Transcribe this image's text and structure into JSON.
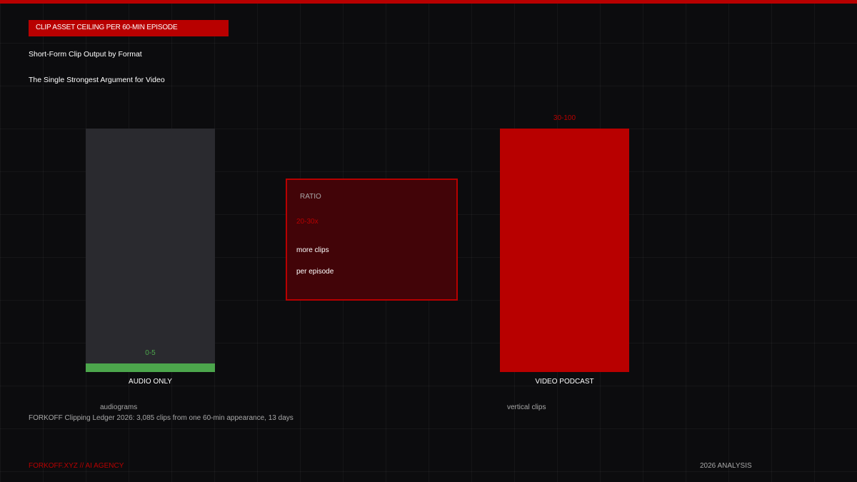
{
  "header": {
    "tag": "CLIP ASSET CEILING PER 60-MIN EPISODE",
    "title": "Short-Form Clip Output by Format",
    "subtitle": "The Single Strongest Argument for Video"
  },
  "chart_data": {
    "type": "bar",
    "title": "Short-Form Clip Output by Format",
    "subtitle": "The Single Strongest Argument for Video",
    "categories": [
      "AUDIO ONLY",
      "VIDEO PODCAST"
    ],
    "series": [
      {
        "values": [
          [
            0,
            5
          ],
          [
            30,
            100
          ]
        ],
        "value_labels": [
          "0-5",
          "30-100"
        ],
        "notes": [
          "audiograms",
          "vertical clips"
        ]
      }
    ],
    "ylim": [
      0,
      100
    ],
    "grid": true,
    "colors": {
      "audio_track": "#2a2a2f",
      "audio_fill": "#4ca64c",
      "video": "#b80000",
      "accent": "#b80000"
    }
  },
  "ratio": {
    "label": "RATIO",
    "value": "20-30x",
    "line1": "more clips",
    "line2": "per episode"
  },
  "source": "FORKOFF Clipping Ledger 2026: 3,085 clips from one 60-min appearance, 13 days",
  "footer": {
    "left": "FORKOFF.XYZ // AI AGENCY",
    "right": "2026 ANALYSIS"
  }
}
